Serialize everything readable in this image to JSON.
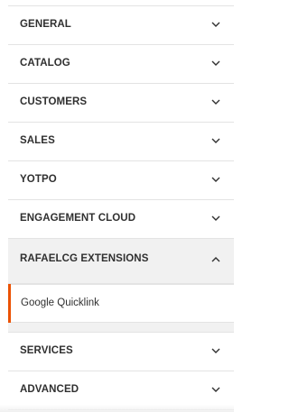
{
  "sections": [
    {
      "label": "GENERAL",
      "icon": "chevron-down-icon"
    },
    {
      "label": "CATALOG",
      "icon": "chevron-down-icon"
    },
    {
      "label": "CUSTOMERS",
      "icon": "chevron-down-icon"
    },
    {
      "label": "SALES",
      "icon": "chevron-down-icon"
    },
    {
      "label": "YOTPO",
      "icon": "chevron-down-icon"
    },
    {
      "label": "ENGAGEMENT CLOUD",
      "icon": "chevron-down-icon"
    },
    {
      "label": "RAFAELCG EXTENSIONS",
      "icon": "chevron-up-icon",
      "expanded": true
    },
    {
      "label": "SERVICES",
      "icon": "chevron-down-icon"
    },
    {
      "label": "ADVANCED",
      "icon": "chevron-down-icon"
    }
  ],
  "subitems": {
    "rafaelcg": [
      {
        "label": "Google Quicklink",
        "active": true
      }
    ]
  },
  "colors": {
    "accent": "#eb5202",
    "text": "#303030",
    "divider": "#e3e3e3",
    "expanded_bg": "#f1f1f1"
  }
}
